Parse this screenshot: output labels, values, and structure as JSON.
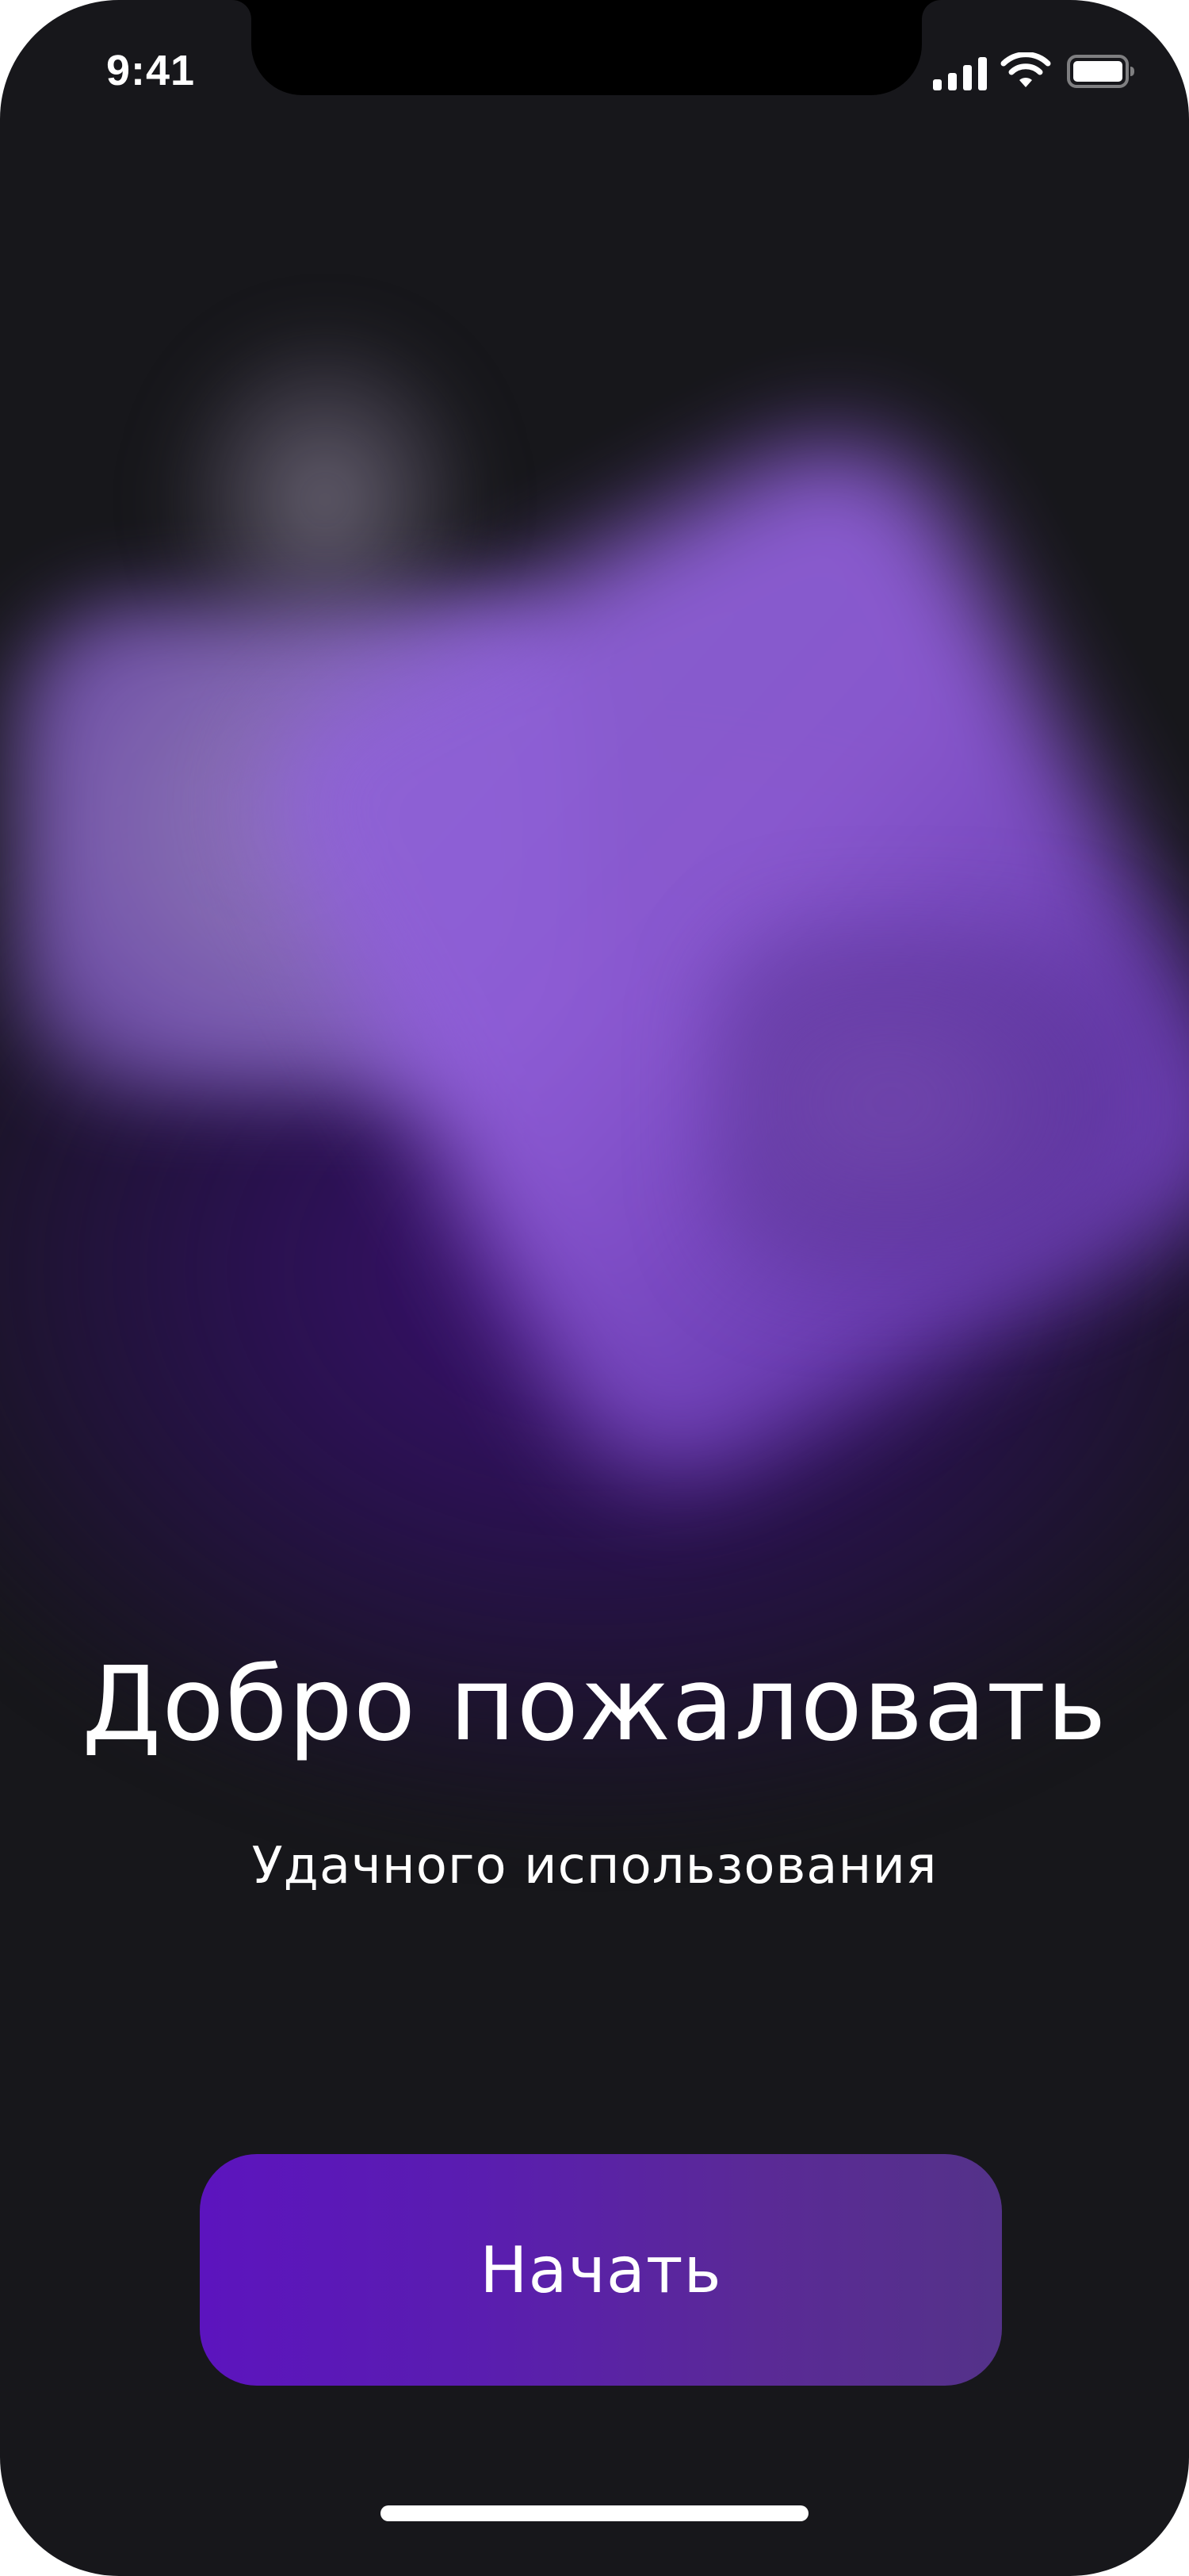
{
  "status_bar": {
    "time": "9:41",
    "icons": [
      "cellular-signal-icon",
      "wifi-icon",
      "battery-icon"
    ]
  },
  "welcome": {
    "title": "Добро пожаловать",
    "subtitle": "Удачного использования"
  },
  "actions": {
    "start_label": "Начать"
  },
  "colors": {
    "background": "#17171b",
    "glow_purple": "#8f5cd8",
    "button_start": "#5c14be",
    "button_end": "#543289",
    "text": "#ffffff"
  }
}
